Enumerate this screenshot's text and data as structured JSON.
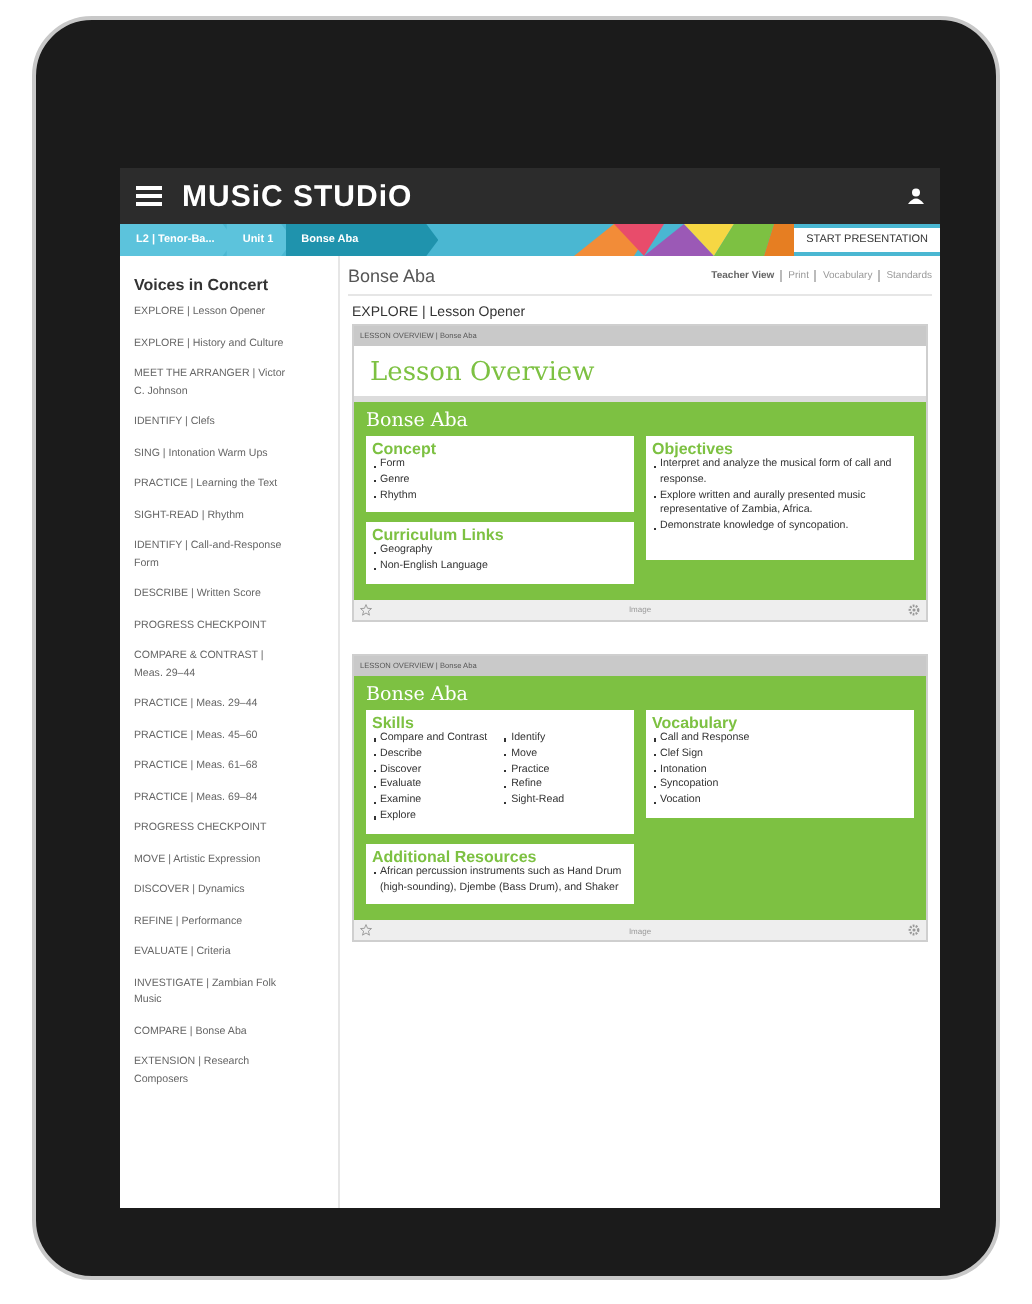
{
  "top_bar": {
    "logo": "MUSiC STUDiO"
  },
  "breadcrumbs": [
    {
      "label": "L2 | Tenor-Ba...",
      "selected": false
    },
    {
      "label": "Unit 1",
      "selected": false
    },
    {
      "label": "Bonse Aba",
      "selected": true
    }
  ],
  "start_button": "START PRESENTATION",
  "sidebar": {
    "title": "Voices in Concert",
    "items": [
      "EXPLORE | Lesson Opener",
      "EXPLORE | History and Culture",
      "MEET THE ARRANGER | Victor C. Johnson",
      "IDENTIFY | Clefs",
      "SING | Intonation Warm Ups",
      "PRACTICE | Learning the Text",
      "SIGHT-READ | Rhythm",
      "IDENTIFY | Call-and-Response Form",
      "DESCRIBE | Written Score",
      "PROGRESS CHECKPOINT",
      "COMPARE & CONTRAST | Meas. 29–44",
      "PRACTICE | Meas. 29–44",
      "PRACTICE | Meas. 45–60",
      "PRACTICE | Meas. 61–68",
      "PRACTICE | Meas. 69–84",
      "PROGRESS CHECKPOINT",
      "MOVE | Artistic Expression",
      "DISCOVER | Dynamics",
      "REFINE | Performance",
      "EVALUATE | Criteria",
      "INVESTIGATE | Zambian Folk Music",
      "COMPARE | Bonse Aba",
      "EXTENSION | Research Composers"
    ]
  },
  "content": {
    "title": "Bonse Aba",
    "view_links": [
      {
        "label": "Teacher View",
        "selected": true
      },
      {
        "label": "Print",
        "selected": false
      },
      {
        "label": "Vocabulary",
        "selected": false
      },
      {
        "label": "Standards",
        "selected": false
      }
    ],
    "section_heading": "EXPLORE | Lesson Opener",
    "cards": [
      {
        "header": "LESSON OVERVIEW | Bonse Aba",
        "banner": "Lesson Overview",
        "subtitle": "Bonse Aba",
        "footer": "Image",
        "left_boxes": [
          {
            "title": "Concept",
            "columns": [
              [
                "Form",
                "Genre",
                "Rhythm"
              ]
            ]
          },
          {
            "title": "Curriculum Links",
            "columns": [
              [
                "Geography",
                "Non-English Language"
              ]
            ]
          }
        ],
        "right_boxes": [
          {
            "title": "Objectives",
            "columns": [
              [
                "Interpret and analyze the musical form of call and response.",
                "Explore written and aurally presented music representative of Zambia, Africa.",
                "Demonstrate knowledge of syncopation."
              ]
            ]
          }
        ]
      },
      {
        "header": "LESSON OVERVIEW | Bonse Aba",
        "subtitle": "Bonse Aba",
        "footer": "Image",
        "left_boxes": [
          {
            "title": "Skills",
            "columns": [
              [
                "Compare and Contrast",
                "Describe",
                "Discover",
                "Evaluate",
                "Examine",
                "Explore"
              ],
              [
                "Identify",
                "Move",
                "Practice",
                "Refine",
                "Sight-Read"
              ]
            ]
          },
          {
            "title": "Additional Resources",
            "columns": [
              [
                "African percussion instruments such as Hand Drum (high-sounding), Djembe (Bass Drum), and Shaker"
              ]
            ]
          }
        ],
        "right_boxes": [
          {
            "title": "Vocabulary",
            "columns": [
              [
                "Call and Response",
                "Clef Sign",
                "Intonation",
                "Syncopation",
                "Vocation"
              ]
            ]
          }
        ]
      }
    ]
  }
}
